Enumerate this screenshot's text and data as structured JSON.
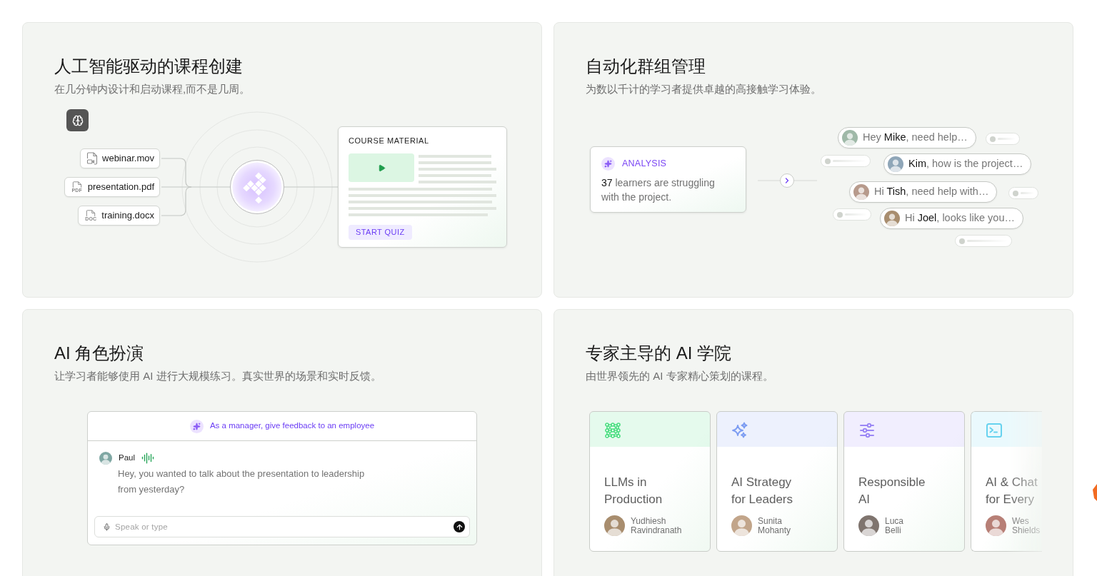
{
  "panels": [
    {
      "kind": "course_builder",
      "title": "人工智能驱动的课程创建",
      "subtitle": "在几分钟内设计和启动课程,而不是几周。",
      "files": [
        {
          "kind": "video",
          "name": "webinar.mov"
        },
        {
          "kind": "document",
          "tag": "PDF",
          "name": "presentation.pdf"
        },
        {
          "kind": "document",
          "tag": "DOC",
          "name": "training.docx"
        }
      ],
      "material": {
        "heading": "COURSE MATERIAL",
        "button": "START QUIZ"
      }
    },
    {
      "kind": "cohorts",
      "title": "自动化群组管理",
      "subtitle": "为数以千计的学习者提供卓越的高接触学习体验。",
      "analysis": {
        "label": "ANALYSIS",
        "text": "**37** learners are struggling with the project."
      },
      "messages": [
        "Hey **Mike**, need help…",
        "**Kim**, how is the project…",
        "Hi **Tish**, need help with…",
        "Hi **Joel**, looks like you…"
      ]
    },
    {
      "kind": "roleplay",
      "title": "AI 角色扮演",
      "subtitle": "让学习者能够使用 AI 进行大规模练习。真实世界的场景和实时反馈。",
      "chat": {
        "prompt": "As a manager, give feedback to an employee",
        "speaker": "Paul",
        "message": "Hey, you wanted to talk about the presentation to leadership from yesterday?",
        "input": {
          "placeholder": "Speak or type"
        }
      }
    },
    {
      "kind": "academy",
      "title": "专家主导的 AI 学院",
      "subtitle": "由世界领先的 AI 专家精心策划的课程。",
      "courses": [
        {
          "title": "LLMs in\nProduction",
          "instructor": "Yudhiesh Ravindranath",
          "color": "#4ade80"
        },
        {
          "title": "AI Strategy\nfor Leaders",
          "instructor": "Sunita Mohanty",
          "color": "#7c9cf2"
        },
        {
          "title": "Responsible\nAI",
          "instructor": "Luca Belli",
          "color": "#9b87f5"
        },
        {
          "title": "AI & Chat\nfor Every",
          "instructor": "Wes Shields",
          "color": "#67d2ef"
        }
      ]
    }
  ]
}
